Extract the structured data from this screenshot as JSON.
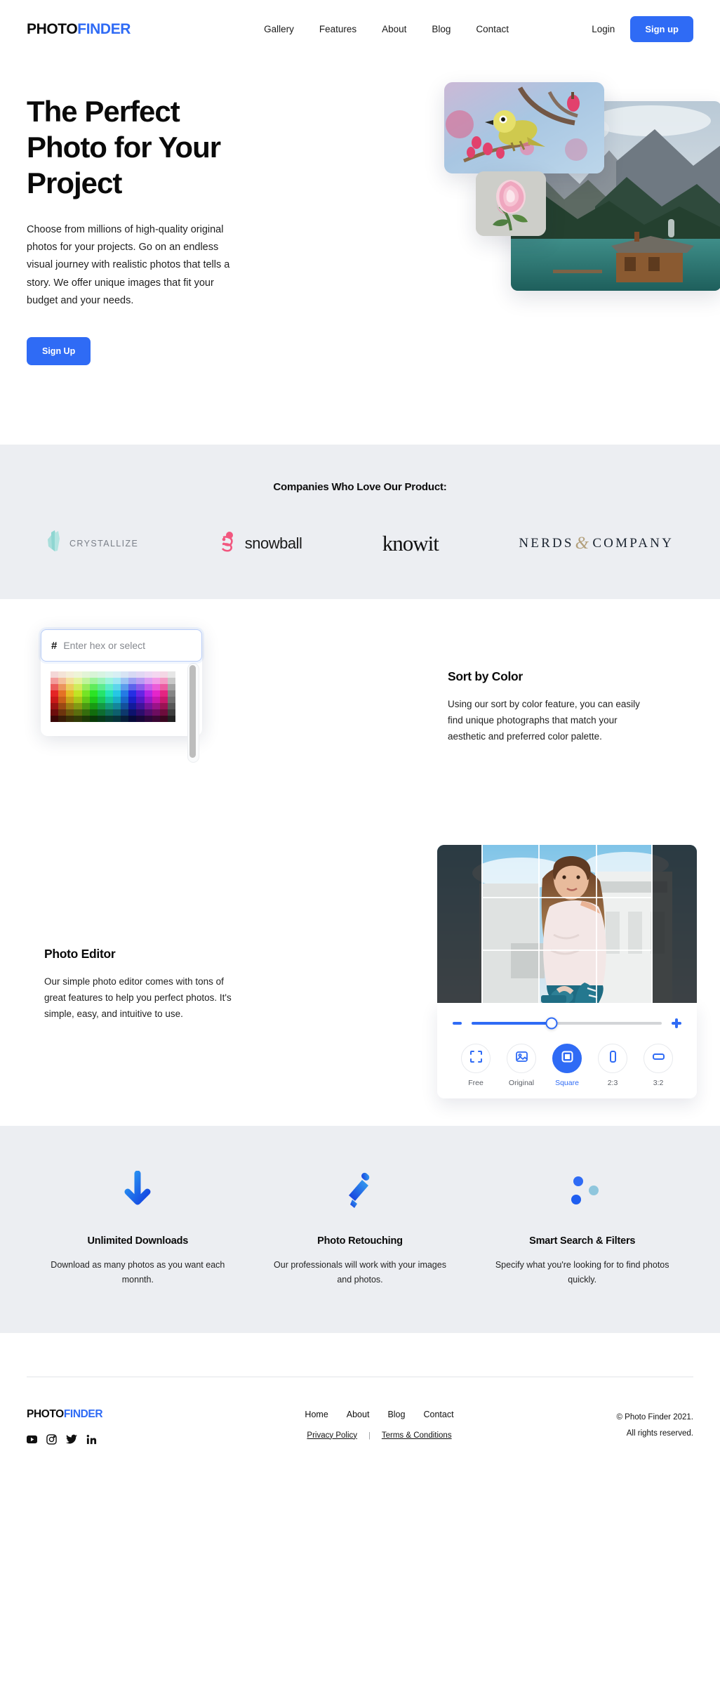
{
  "brand": {
    "part1": "PHOTO",
    "part2": "FINDER",
    "accent": "#2f6bf5"
  },
  "header": {
    "nav": [
      {
        "label": "Gallery"
      },
      {
        "label": "Features"
      },
      {
        "label": "About"
      },
      {
        "label": "Blog"
      },
      {
        "label": "Contact"
      }
    ],
    "login_label": "Login",
    "signup_label": "Sign up"
  },
  "hero": {
    "title": "The Perfect Photo for Your Project",
    "paragraph": "Choose from millions of high-quality original photos for your projects. Go on an endless visual journey with realistic photos that tells a story. We offer unique images that fit your budget and your needs.",
    "cta_label": "Sign Up",
    "images": [
      {
        "name": "bird-on-blossom-branch"
      },
      {
        "name": "mountain-lake-cabin"
      },
      {
        "name": "pink-rose"
      }
    ]
  },
  "companies": {
    "heading": "Companies Who Love Our Product:",
    "logos": [
      {
        "name": "crystallize",
        "text": "CRYSTALLIZE"
      },
      {
        "name": "snowball",
        "text": "snowball"
      },
      {
        "name": "knowit",
        "text": "knowit"
      },
      {
        "name": "nerds-and-company",
        "text_a": "NERDS",
        "amp": "&",
        "text_b": "COMPANY"
      }
    ]
  },
  "sort_by_color": {
    "title": "Sort by Color",
    "paragraph": "Using our sort by color feature, you can easily find unique photographs that match your aesthetic and preferred color palette.",
    "hex_prefix": "#",
    "hex_value": "",
    "hex_placeholder": "Enter hex or select"
  },
  "photo_editor": {
    "title": "Photo Editor",
    "paragraph": "Our simple photo editor comes with tons of great features to help you perfect photos. It's simple, easy, and intuitive to use.",
    "zoom_percent": 42,
    "minus_label": "−",
    "plus_label": "+",
    "ratios": [
      {
        "label": "Free",
        "icon": "crop-free-icon",
        "active": false
      },
      {
        "label": "Original",
        "icon": "image-original-icon",
        "active": false
      },
      {
        "label": "Square",
        "icon": "square-icon",
        "active": true
      },
      {
        "label": "2:3",
        "icon": "portrait-icon",
        "active": false
      },
      {
        "label": "3:2",
        "icon": "landscape-icon",
        "active": false
      }
    ]
  },
  "benefits": [
    {
      "icon": "download-arrow-icon",
      "title": "Unlimited Downloads",
      "text": "Download as many photos as you want each monnth."
    },
    {
      "icon": "eyedropper-icon",
      "title": "Photo Retouching",
      "text": "Our professionals will work with your images and photos."
    },
    {
      "icon": "sliders-icon",
      "title": "Smart Search & Filters",
      "text": "Specify what you're looking for to find photos quickly."
    }
  ],
  "footer": {
    "links": [
      {
        "label": "Home"
      },
      {
        "label": "About"
      },
      {
        "label": "Blog"
      },
      {
        "label": "Contact"
      }
    ],
    "privacy_label": "Privacy Policy",
    "separator": "|",
    "terms_label": "Terms & Conditions",
    "copyright": "© Photo Finder 2021.",
    "rights": "All rights reserved.",
    "socials": [
      {
        "name": "youtube-icon"
      },
      {
        "name": "instagram-icon"
      },
      {
        "name": "twitter-icon"
      },
      {
        "name": "linkedin-icon"
      }
    ]
  }
}
